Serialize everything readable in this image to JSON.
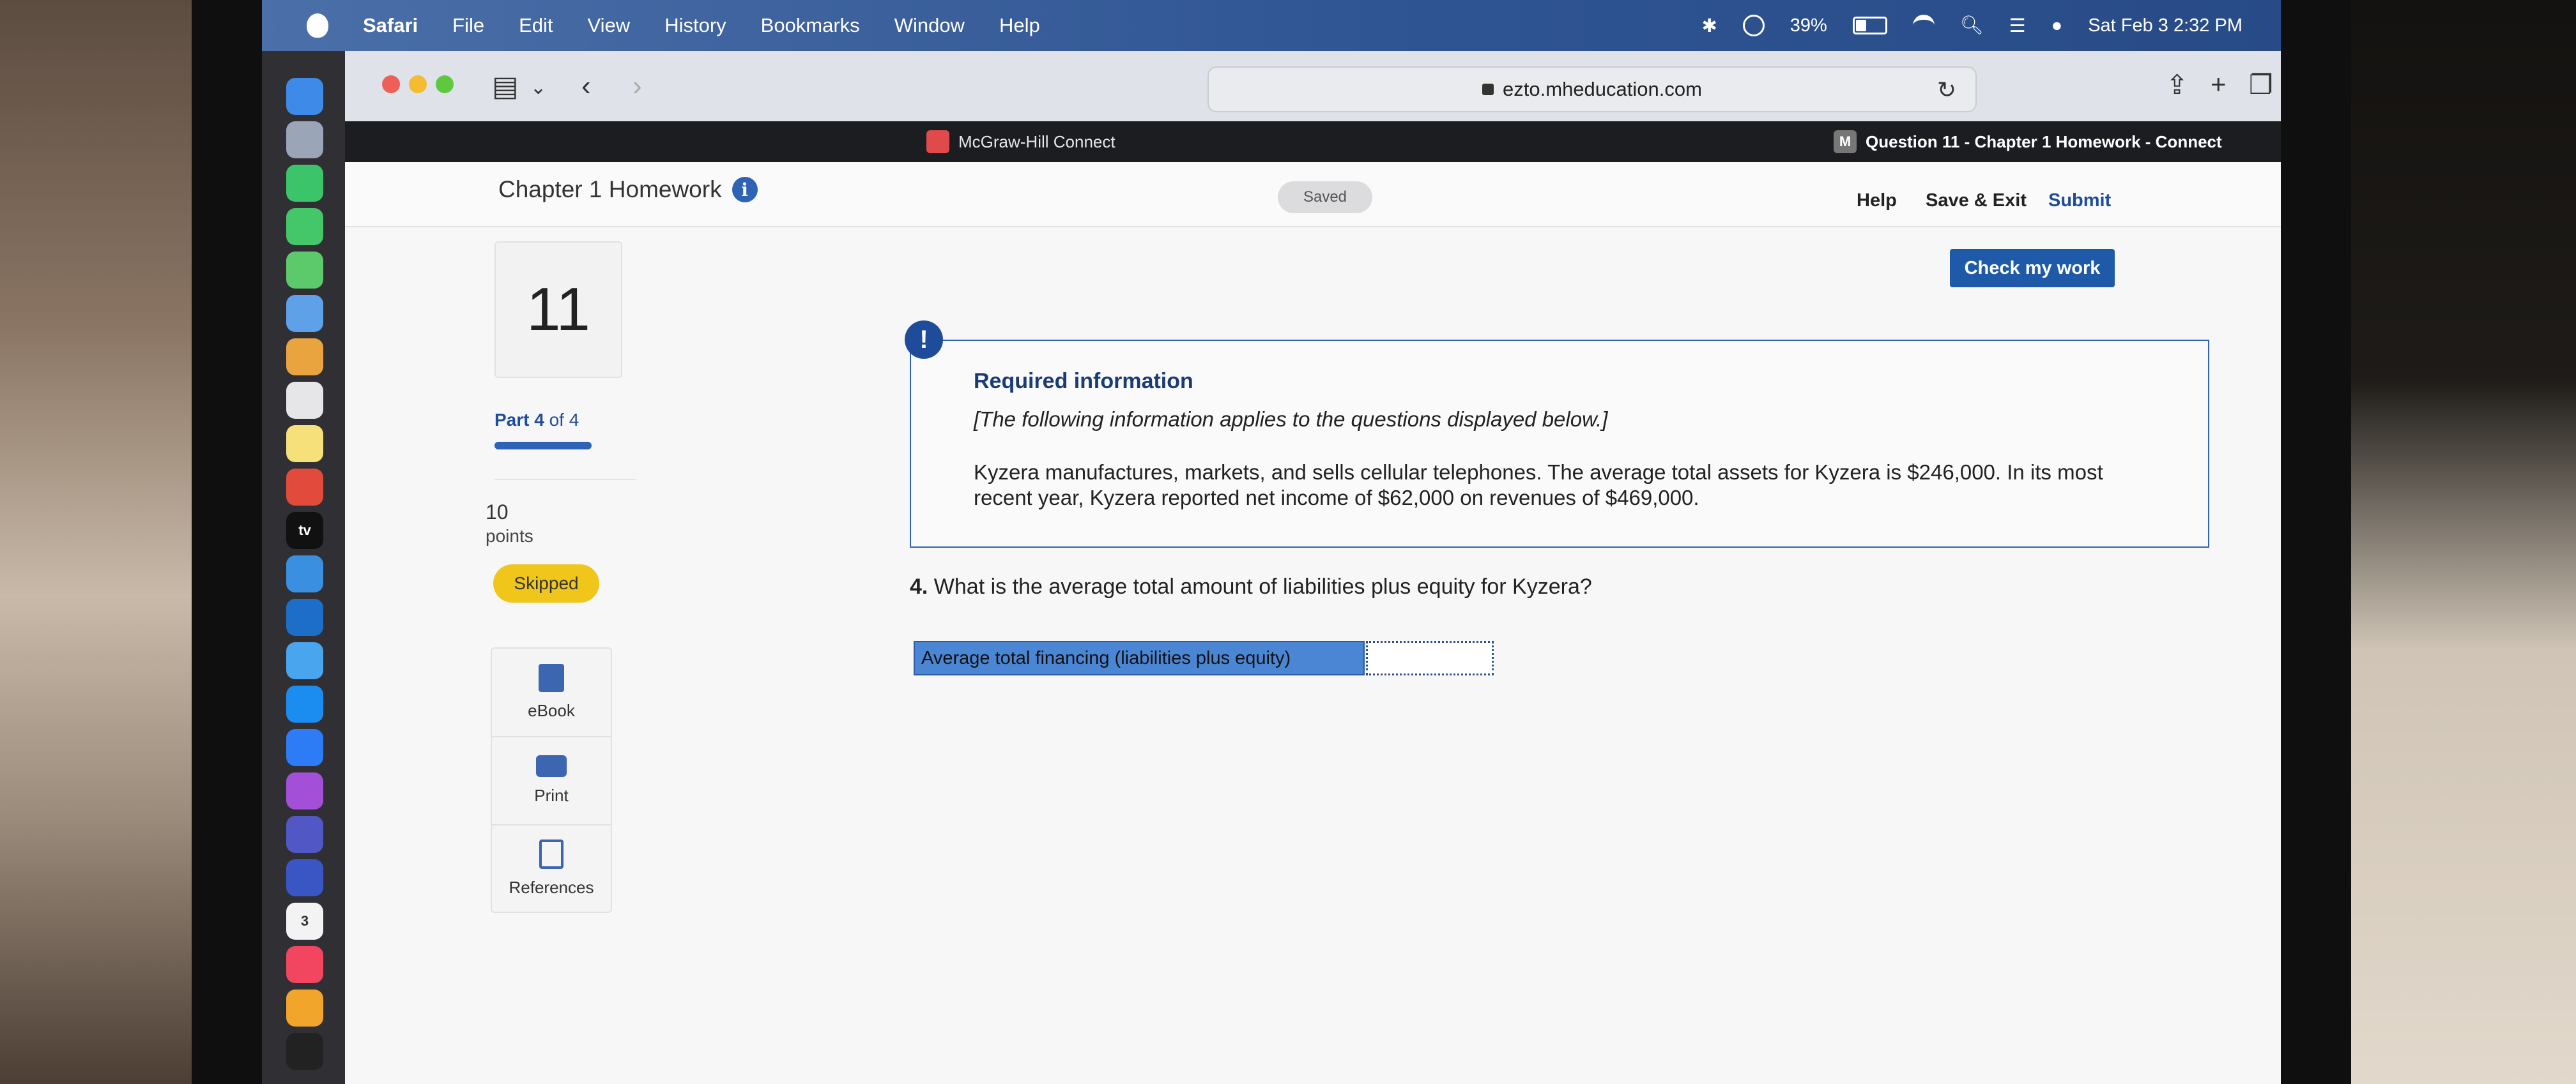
{
  "menubar": {
    "items": [
      "Safari",
      "File",
      "Edit",
      "View",
      "History",
      "Bookmarks",
      "Window",
      "Help"
    ],
    "battery": "39%",
    "datetime": "Sat Feb 3  2:32 PM"
  },
  "dock": {
    "calendar_day": "3",
    "tv_label": "tv"
  },
  "browser": {
    "url": "ezto.mheducation.com",
    "tabs": [
      {
        "title": "McGraw-Hill Connect",
        "favicon": ""
      },
      {
        "title": "Question 11 - Chapter 1 Homework - Connect",
        "favicon": "M"
      }
    ]
  },
  "header": {
    "title": "Chapter 1 Homework",
    "info_icon": "i",
    "saved_label": "Saved",
    "help_label": "Help",
    "save_exit_label": "Save & Exit",
    "submit_label": "Submit",
    "check_label": "Check my work"
  },
  "sidebar": {
    "question_number": "11",
    "part_bold": "Part 4",
    "part_rest": " of 4",
    "part_progress": 1.0,
    "points_value": "10",
    "points_label": "points",
    "status": "Skipped",
    "tools": [
      {
        "label": "eBook",
        "icon": "book-icon"
      },
      {
        "label": "Print",
        "icon": "printer-icon"
      },
      {
        "label": "References",
        "icon": "references-icon"
      }
    ]
  },
  "required": {
    "alert_icon": "!",
    "title": "Required information",
    "subtitle": "[The following information applies to the questions displayed below.]",
    "text": "Kyzera manufactures, markets, and sells cellular telephones. The average total assets for Kyzera is $246,000. In its most recent year, Kyzera reported net income of $62,000 on revenues of $469,000."
  },
  "question": {
    "number": "4.",
    "text": " What is the average total amount of liabilities plus equity for Kyzera?",
    "answer_label": "Average total financing (liabilities plus equity)",
    "answer_value": ""
  },
  "colors": {
    "brand_blue": "#1e5aa8",
    "skipped_yellow": "#f1c61b",
    "answer_label_bg": "#4a86d4"
  }
}
